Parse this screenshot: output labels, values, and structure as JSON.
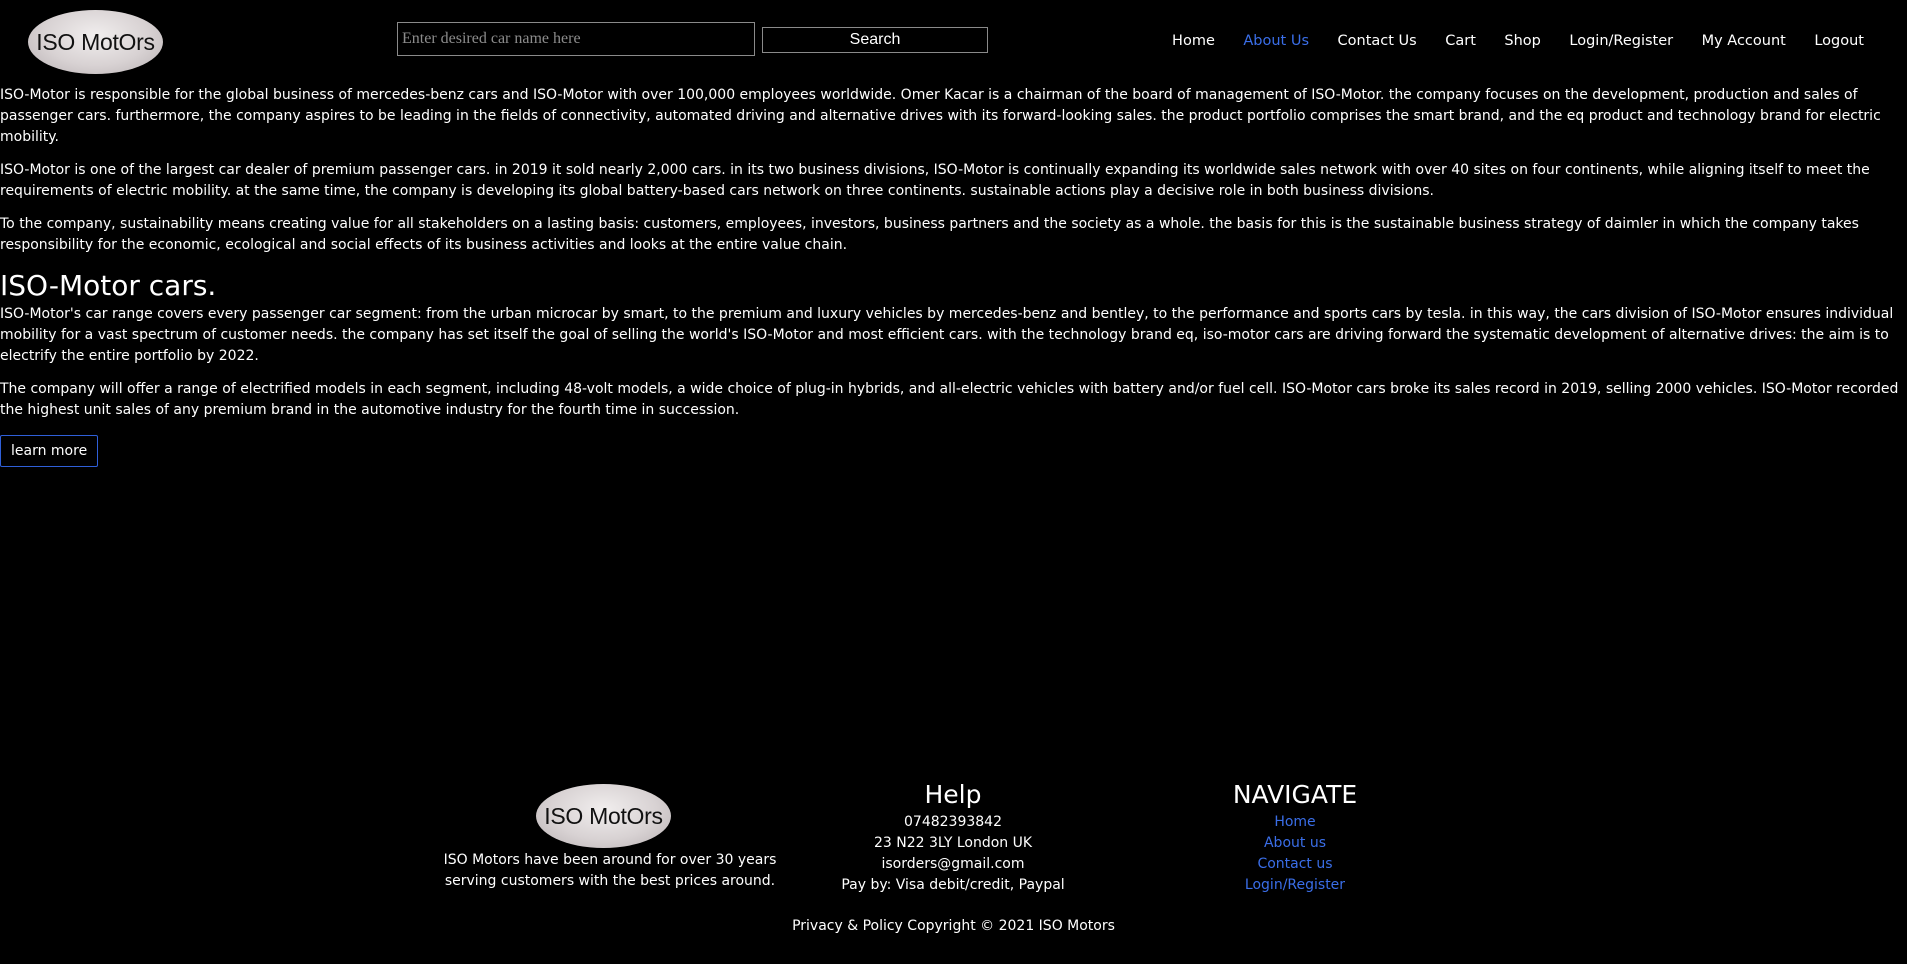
{
  "header": {
    "logo_text": "ISO MotOrs",
    "search": {
      "placeholder": "Enter desired car name here",
      "value": "",
      "button_label": "Search"
    },
    "nav": [
      {
        "label": "Home",
        "active": false
      },
      {
        "label": "About Us",
        "active": true
      },
      {
        "label": "Contact Us",
        "active": false
      },
      {
        "label": "Cart",
        "active": false
      },
      {
        "label": "Shop",
        "active": false
      },
      {
        "label": "Login/Register",
        "active": false
      },
      {
        "label": "My Account",
        "active": false
      },
      {
        "label": "Logout",
        "active": false
      }
    ]
  },
  "main": {
    "intro_paragraphs": [
      "ISO-Motor is responsible for the global business of mercedes-benz cars and ISO-Motor with over 100,000 employees worldwide. Omer Kacar is a chairman of the board of management of ISO-Motor. the company focuses on the development, production and sales of passenger cars. furthermore, the company aspires to be leading in the fields of connectivity, automated driving and alternative drives with its forward-looking sales. the product portfolio comprises the smart brand, and the eq product and technology brand for electric mobility.",
      "ISO-Motor is one of the largest car dealer of premium passenger cars. in 2019 it sold nearly 2,000 cars. in its two business divisions, ISO-Motor is continually expanding its worldwide sales network with over 40 sites on four continents, while aligning itself to meet the requirements of electric mobility. at the same time, the company is developing its global battery-based cars network on three continents. sustainable actions play a decisive role in both business divisions.",
      "To the company, sustainability means creating value for all stakeholders on a lasting basis: customers, employees, investors, business partners and the society as a whole. the basis for this is the sustainable business strategy of daimler in which the company takes responsibility for the economic, ecological and social effects of its business activities and looks at the entire value chain."
    ],
    "cars_heading": "ISO-Motor cars.",
    "cars_paragraphs": [
      "ISO-Motor's car range covers every passenger car segment: from the urban microcar by smart, to the premium and luxury vehicles by mercedes-benz and bentley, to the performance and sports cars by tesla. in this way, the cars division of ISO-Motor ensures individual mobility for a vast spectrum of customer needs. the company has set itself the goal of selling the world's ISO-Motor and most efficient cars. with the technology brand eq, iso-motor cars are driving forward the systematic development of alternative drives: the aim is to electrify the entire portfolio by 2022.",
      "The company will offer a range of electrified models in each segment, including 48-volt models, a wide choice of plug-in hybrids, and all-electric vehicles with battery and/or fuel cell. ISO-Motor cars broke its sales record in 2019, selling 2000 vehicles. ISO-Motor recorded the highest unit sales of any premium brand in the automotive industry for the fourth time in succession."
    ],
    "learn_more_label": "learn more"
  },
  "footer": {
    "logo_text": "ISO MotOrs",
    "about_lines": [
      "ISO Motors have been around for over 30 years",
      "serving customers with the best prices around."
    ],
    "help": {
      "title": "Help",
      "phone": "07482393842",
      "address": "23 N22 3LY London UK",
      "email": "isorders@gmail.com",
      "pay": "Pay by: Visa debit/credit, Paypal"
    },
    "navigate": {
      "title": "NAVIGATE",
      "links": [
        "Home",
        "About us",
        "Contact us",
        "Login/Register"
      ]
    },
    "copyright": "Privacy & Policy Copyright © 2021 ISO Motors"
  },
  "colors": {
    "background": "#000000",
    "text": "#ffffff",
    "link_blue": "#3a6ee8",
    "button_border": "#2f5fd8"
  }
}
